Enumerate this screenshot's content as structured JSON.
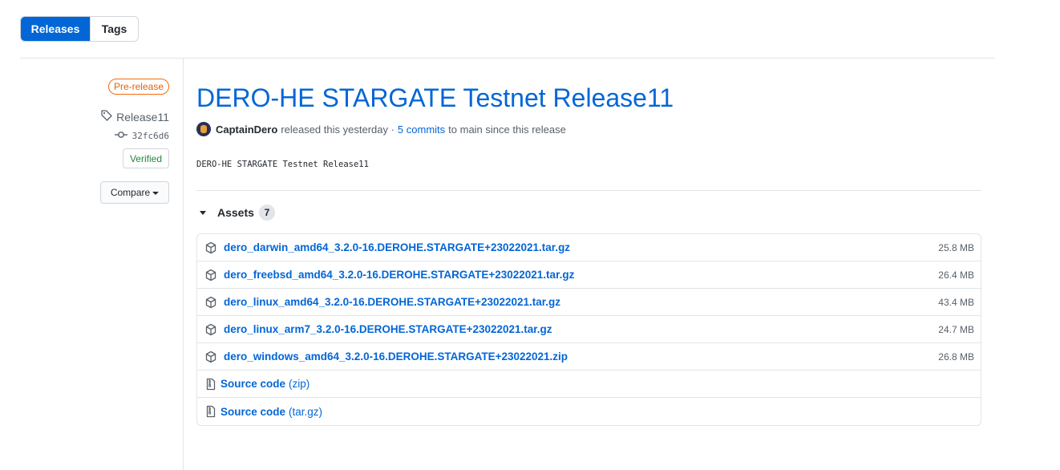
{
  "tabs": {
    "releases": "Releases",
    "tags": "Tags"
  },
  "sidebar": {
    "prerelease_label": "Pre-release",
    "tag_name": "Release11",
    "commit_sha": "32fc6d6",
    "verified_label": "Verified",
    "compare_label": "Compare"
  },
  "release": {
    "title": "DERO-HE STARGATE Testnet Release11",
    "author": "CaptainDero",
    "released_text": "released this yesterday ·",
    "commits_link": "5 commits",
    "commits_suffix": "to main since this release",
    "body": "DERO-HE STARGATE Testnet Release11"
  },
  "assets": {
    "label": "Assets",
    "count": "7",
    "files": [
      {
        "name": "dero_darwin_amd64_3.2.0-16.DEROHE.STARGATE+23022021.tar.gz",
        "size": "25.8 MB"
      },
      {
        "name": "dero_freebsd_amd64_3.2.0-16.DEROHE.STARGATE+23022021.tar.gz",
        "size": "26.4 MB"
      },
      {
        "name": "dero_linux_amd64_3.2.0-16.DEROHE.STARGATE+23022021.tar.gz",
        "size": "43.4 MB"
      },
      {
        "name": "dero_linux_arm7_3.2.0-16.DEROHE.STARGATE+23022021.tar.gz",
        "size": "24.7 MB"
      },
      {
        "name": "dero_windows_amd64_3.2.0-16.DEROHE.STARGATE+23022021.zip",
        "size": "26.8 MB"
      }
    ],
    "source": [
      {
        "name": "Source code",
        "suffix": "(zip)"
      },
      {
        "name": "Source code",
        "suffix": "(tar.gz)"
      }
    ]
  },
  "colors": {
    "accent": "#0366d6",
    "prerelease": "#e36209",
    "verified": "#22863a"
  },
  "icons": [
    "tag-icon",
    "commit-icon",
    "caret-down-icon",
    "package-icon",
    "file-zip-icon"
  ]
}
